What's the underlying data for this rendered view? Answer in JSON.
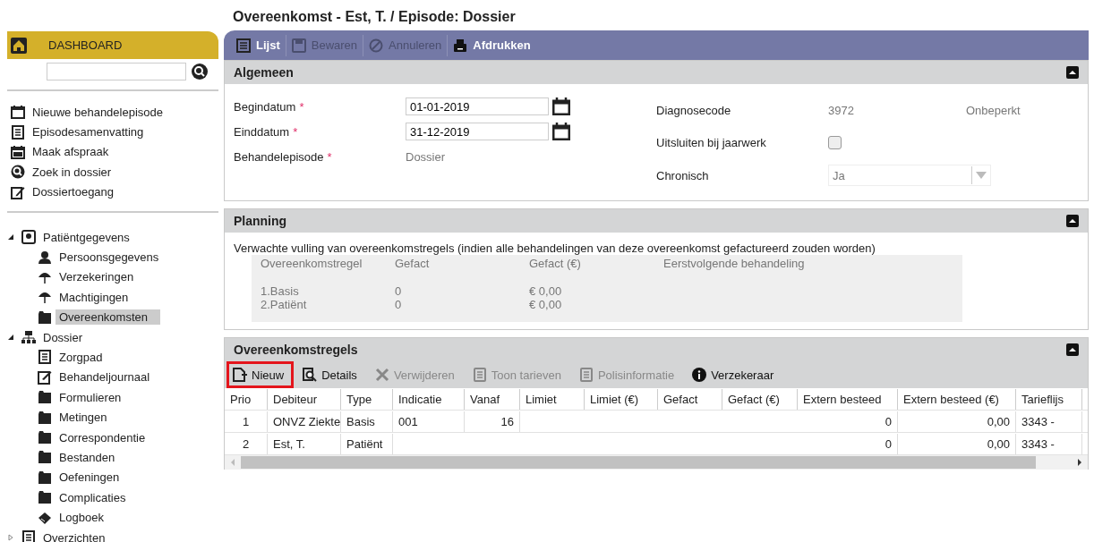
{
  "title": "Overeenkomst - Est, T. / Episode: Dossier",
  "sidebar": {
    "dashboard": "DASHBOARD",
    "links": [
      {
        "label": "Nieuwe behandelepisode",
        "kind": "calendar"
      },
      {
        "label": "Episodesamenvatting",
        "kind": "list"
      },
      {
        "label": "Maak afspraak",
        "kind": "agenda"
      },
      {
        "label": "Zoek in dossier",
        "kind": "search"
      },
      {
        "label": "Dossiertoegang",
        "kind": "edit"
      }
    ],
    "tree": [
      {
        "label": "Patiëntgegevens",
        "kind": "patient",
        "expanded": true,
        "children": [
          {
            "label": "Persoonsgegevens",
            "kind": "person",
            "selected": false
          },
          {
            "label": "Verzekeringen",
            "kind": "umbrella",
            "selected": false
          },
          {
            "label": "Machtigingen",
            "kind": "umbrella",
            "selected": false
          },
          {
            "label": "Overeenkomsten",
            "kind": "folder",
            "selected": true
          }
        ]
      },
      {
        "label": "Dossier",
        "kind": "network",
        "expanded": true,
        "children": [
          {
            "label": "Zorgpad",
            "kind": "list",
            "selected": false
          },
          {
            "label": "Behandeljournaal",
            "kind": "edit",
            "selected": false
          },
          {
            "label": "Formulieren",
            "kind": "folder",
            "selected": false
          },
          {
            "label": "Metingen",
            "kind": "folder",
            "selected": false
          },
          {
            "label": "Correspondentie",
            "kind": "folder",
            "selected": false
          },
          {
            "label": "Bestanden",
            "kind": "folder",
            "selected": false
          },
          {
            "label": "Oefeningen",
            "kind": "folder",
            "selected": false
          },
          {
            "label": "Complicaties",
            "kind": "folder",
            "selected": false
          },
          {
            "label": "Logboek",
            "kind": "book",
            "selected": false
          }
        ]
      },
      {
        "label": "Overzichten",
        "kind": "list",
        "expanded": false
      }
    ]
  },
  "toolbar": [
    {
      "label": "Lijst",
      "kind": "list",
      "disabled": false
    },
    {
      "label": "Bewaren",
      "kind": "save",
      "disabled": true
    },
    {
      "label": "Annuleren",
      "kind": "cancel",
      "disabled": true
    },
    {
      "label": "Afdrukken",
      "kind": "printer",
      "disabled": false
    }
  ],
  "algemeen": {
    "title": "Algemeen",
    "left": [
      {
        "label": "Begindatum",
        "required_mark": "*",
        "kind": "date",
        "value": "01-01-2019"
      },
      {
        "label": "Einddatum",
        "required_mark": "*",
        "kind": "date",
        "value": "31-12-2019"
      },
      {
        "label": "Behandelepisode",
        "required_mark": "*",
        "kind": "text",
        "value": "Dossier"
      }
    ],
    "right": [
      {
        "label": "Diagnosecode",
        "kind": "text",
        "value": "3972",
        "extra": "Onbeperkt"
      },
      {
        "label": "Uitsluiten bij jaarwerk",
        "kind": "checkbox",
        "checked": false
      },
      {
        "label": "Chronisch",
        "kind": "select",
        "value": "Ja"
      }
    ]
  },
  "planning": {
    "title": "Planning",
    "intro": "Verwachte vulling van overeenkomstregels (indien alle behandelingen van deze overeenkomst gefactureerd zouden worden)",
    "columns": [
      "Overeenkomstregel",
      "Gefact",
      "Gefact (€)",
      "Eerstvolgende behandeling"
    ],
    "rows": [
      [
        "1.Basis",
        "0",
        "€ 0,00"
      ],
      [
        "2.Patiënt",
        "0",
        "€ 0,00"
      ]
    ]
  },
  "regels": {
    "title": "Overeenkomstregels",
    "toolbar": [
      {
        "label": "Nieuw",
        "kind": "new",
        "disabled": false,
        "highlighted": true
      },
      {
        "label": "Details",
        "kind": "search",
        "disabled": false,
        "highlighted": false
      },
      {
        "label": "Verwijderen",
        "kind": "cross",
        "disabled": true,
        "highlighted": false
      },
      {
        "label": "Toon tarieven",
        "kind": "doc",
        "disabled": true,
        "highlighted": false
      },
      {
        "label": "Polisinformatie",
        "kind": "doc",
        "disabled": true,
        "highlighted": false
      },
      {
        "label": "Verzekeraar",
        "kind": "info",
        "disabled": false,
        "highlighted": false
      }
    ],
    "columns": [
      "Prio",
      "Debiteur",
      "Type",
      "Indicatie",
      "Vanaf",
      "Limiet",
      "Limiet (€)",
      "Gefact",
      "Gefact (€)",
      "Extern besteed",
      "Extern besteed (€)",
      "Tarieflijs"
    ],
    "rows": [
      [
        "1",
        "ONVZ Ziekte",
        "Basis",
        "001",
        "16",
        "",
        "",
        "",
        "",
        "0",
        "0,00",
        "3343 -"
      ],
      [
        "2",
        "Est, T.",
        "Patiënt",
        "",
        "",
        "",
        "",
        "",
        "",
        "0",
        "0,00",
        "3343 -"
      ]
    ]
  }
}
